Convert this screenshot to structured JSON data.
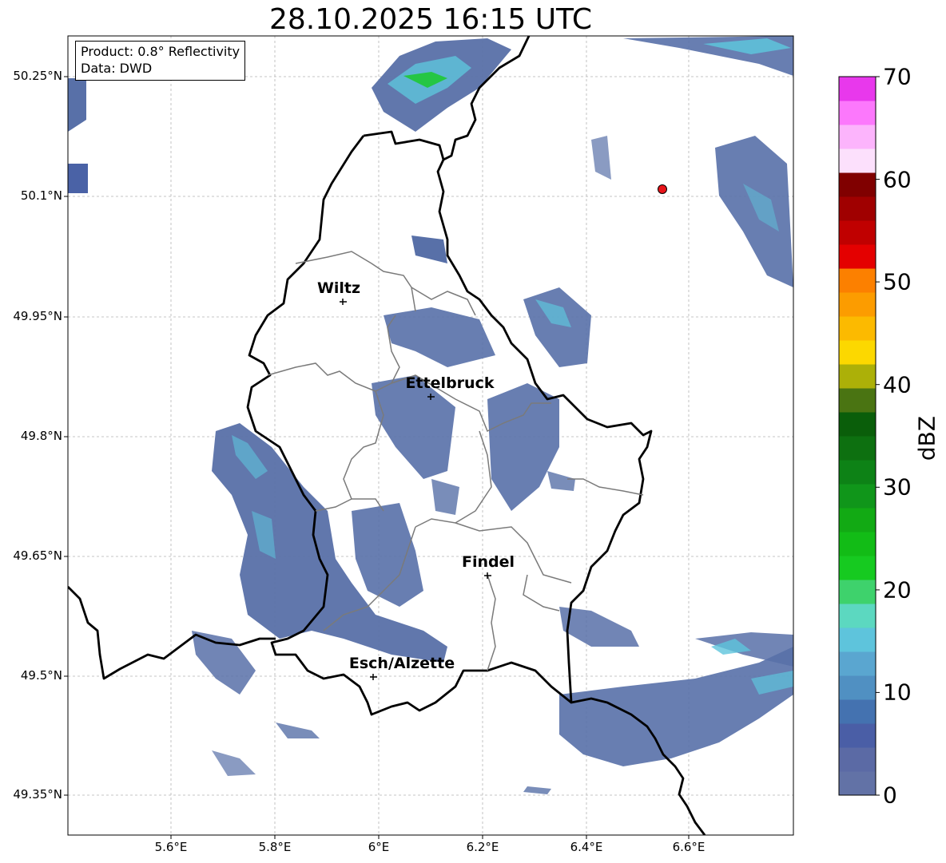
{
  "title": "28.10.2025 16:15 UTC",
  "info_box": {
    "product": "Product: 0.8° Reflectivity",
    "data": "Data: DWD"
  },
  "map": {
    "lat_ticks": [
      "50.25°N",
      "50.1°N",
      "49.95°N",
      "49.8°N",
      "49.65°N",
      "49.5°N",
      "49.35°N"
    ],
    "lon_ticks": [
      "5.6°E",
      "5.8°E",
      "6°E",
      "6.2°E",
      "6.4°E",
      "6.6°E"
    ],
    "cities": [
      {
        "name": "Wiltz"
      },
      {
        "name": "Ettelbruck"
      },
      {
        "name": "Findel"
      },
      {
        "name": "Esch/Alzette"
      }
    ],
    "radar_marker_color": "#e8141a"
  },
  "colorbar": {
    "label": "dBZ",
    "ticks": [
      "0",
      "10",
      "20",
      "30",
      "40",
      "50",
      "60",
      "70"
    ],
    "colors": [
      "#6272a6",
      "#5b6aa5",
      "#4a5ea6",
      "#4472b0",
      "#5090c2",
      "#5aa6d0",
      "#5ec4dc",
      "#5cd8c0",
      "#3ed26c",
      "#16ca20",
      "#12bc16",
      "#12aa14",
      "#10961a",
      "#0d8216",
      "#0d7010",
      "#0a5e0a",
      "#4a7412",
      "#acb008",
      "#fcd800",
      "#fcba00",
      "#fc9c00",
      "#fc8000",
      "#e40000",
      "#c00000",
      "#a00000",
      "#800000",
      "#fce0fc",
      "#fcb4fc",
      "#fc78fc",
      "#e838ec"
    ]
  }
}
